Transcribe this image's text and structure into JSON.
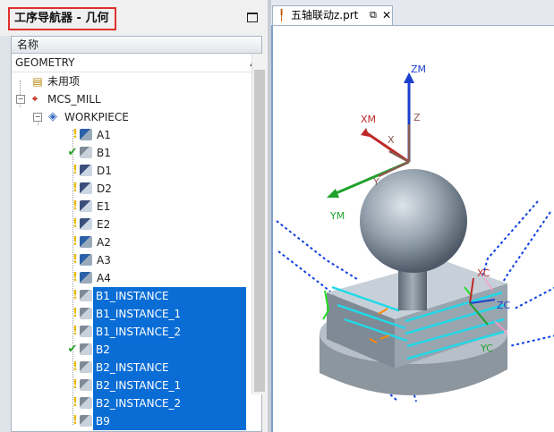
{
  "navigator": {
    "title": "工序导航器 - 几何",
    "column_header": "名称",
    "root": "GEOMETRY",
    "unused": "未用项",
    "mcs": "MCS_MILL",
    "workpiece": "WORKPIECE",
    "operations": [
      {
        "label": "A1",
        "status": "bulb",
        "icon": "op-a",
        "selected": false
      },
      {
        "label": "B1",
        "status": "check",
        "icon": "op-b",
        "selected": false
      },
      {
        "label": "D1",
        "status": "bulb",
        "icon": "op-d",
        "selected": false
      },
      {
        "label": "D2",
        "status": "bulb",
        "icon": "op-d",
        "selected": false
      },
      {
        "label": "E1",
        "status": "bulb",
        "icon": "op-d",
        "selected": false
      },
      {
        "label": "E2",
        "status": "bulb",
        "icon": "op-d",
        "selected": false
      },
      {
        "label": "A2",
        "status": "bulb",
        "icon": "op-a",
        "selected": false
      },
      {
        "label": "A3",
        "status": "bulb",
        "icon": "op-a",
        "selected": false
      },
      {
        "label": "A4",
        "status": "bulb",
        "icon": "op-a",
        "selected": false
      },
      {
        "label": "B1_INSTANCE",
        "status": "bulb",
        "icon": "op-b",
        "selected": true
      },
      {
        "label": "B1_INSTANCE_1",
        "status": "bulb",
        "icon": "op-b",
        "selected": true
      },
      {
        "label": "B1_INSTANCE_2",
        "status": "bulb",
        "icon": "op-b",
        "selected": true
      },
      {
        "label": "B2",
        "status": "check",
        "icon": "op-b",
        "selected": true
      },
      {
        "label": "B2_INSTANCE",
        "status": "bulb",
        "icon": "op-b",
        "selected": true
      },
      {
        "label": "B2_INSTANCE_1",
        "status": "bulb",
        "icon": "op-b",
        "selected": true
      },
      {
        "label": "B2_INSTANCE_2",
        "status": "bulb",
        "icon": "op-b",
        "selected": true
      },
      {
        "label": "B9",
        "status": "bulb",
        "icon": "op-b",
        "selected": true
      }
    ]
  },
  "graphics": {
    "tab_label": "五轴联动z.prt",
    "axes": {
      "zm": "ZM",
      "xm": "XM",
      "ym": "YM",
      "z": "Z",
      "x": "X",
      "y": "Y",
      "zc": "ZC",
      "xc": "XC",
      "yc": "YC"
    }
  },
  "colors": {
    "selection": "#0a6dd6",
    "highlight_box": "#e0302b",
    "check": "#2aa02a",
    "bulb": "#e8b800"
  }
}
